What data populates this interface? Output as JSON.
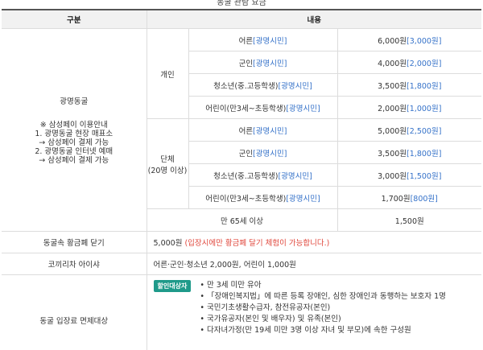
{
  "caption": "동굴 관람 요금",
  "header": {
    "col_category": "구분",
    "col_content": "내용"
  },
  "group_main": {
    "label": "광명동굴",
    "rules": [
      "※ 삼성페이 이용안내",
      "1. 광명동굴 현장 매표소",
      "→ 삼성페이 결제 가능",
      "2. 광명동굴 인터넷 예매",
      "→ 삼성페이 결제 가능"
    ]
  },
  "individual": {
    "label": "개인",
    "rows": [
      {
        "type": "어른",
        "tag": "[광명시민]",
        "price": "6,000원",
        "tag_price": "[3,000원]"
      },
      {
        "type": "군인",
        "tag": "[광명시민]",
        "price": "4,000원",
        "tag_price": "[2,000원]"
      },
      {
        "type": "청소년(중.고등학생)",
        "tag": "[광명시민]",
        "price": "3,500원",
        "tag_price": "[1,800원]"
      },
      {
        "type": "어린이(만3세~초등학생)",
        "tag": "[광명시민]",
        "price": "2,000원",
        "tag_price": "[1,000원]"
      }
    ]
  },
  "group": {
    "label": "단체",
    "sublabel": "(20명 이상)",
    "rows": [
      {
        "type": "어른",
        "tag": "[광명시민]",
        "price": "5,000원",
        "tag_price": "[2,500원]"
      },
      {
        "type": "군인",
        "tag": "[광명시민]",
        "price": "3,500원",
        "tag_price": "[1,800원]"
      },
      {
        "type": "청소년(중.고등학생)",
        "tag": "[광명시민]",
        "price": "3,000원",
        "tag_price": "[1,500원]"
      },
      {
        "type": "어린이(만3세~초등학생)",
        "tag": "[광명시민]",
        "price": "1,700원",
        "tag_price": "[800원]"
      }
    ]
  },
  "senior": {
    "label": "만 65세 이상",
    "price": "1,500원"
  },
  "gold_fee": {
    "label": "동굴속 황금폐 닫기",
    "price": "5,000원",
    "note": "(입장시에만 황금폐 달기 체험이 가능합니다.)"
  },
  "comaerica": {
    "label": "코끼리차 아이샤",
    "text": "어른·군인·청소년 2,000원, 어린이 1,000원"
  },
  "exemption": {
    "label": "동굴 입장료 면제대상",
    "badge": "할인대상자",
    "items": [
      "만 3세 미만 유아",
      "「장애인복지법」에 따른 등록 장애인, 심한 장애인과 동행하는 보호자 1명",
      "국민기초생활수급자, 참전유공자(본인)",
      "국가유공자(본인 및 배우자) 및 유족(본인)",
      "다자녀가정(만 19세 미만 3명 이상 자녀 및 부모)에 속한 구성원"
    ]
  }
}
